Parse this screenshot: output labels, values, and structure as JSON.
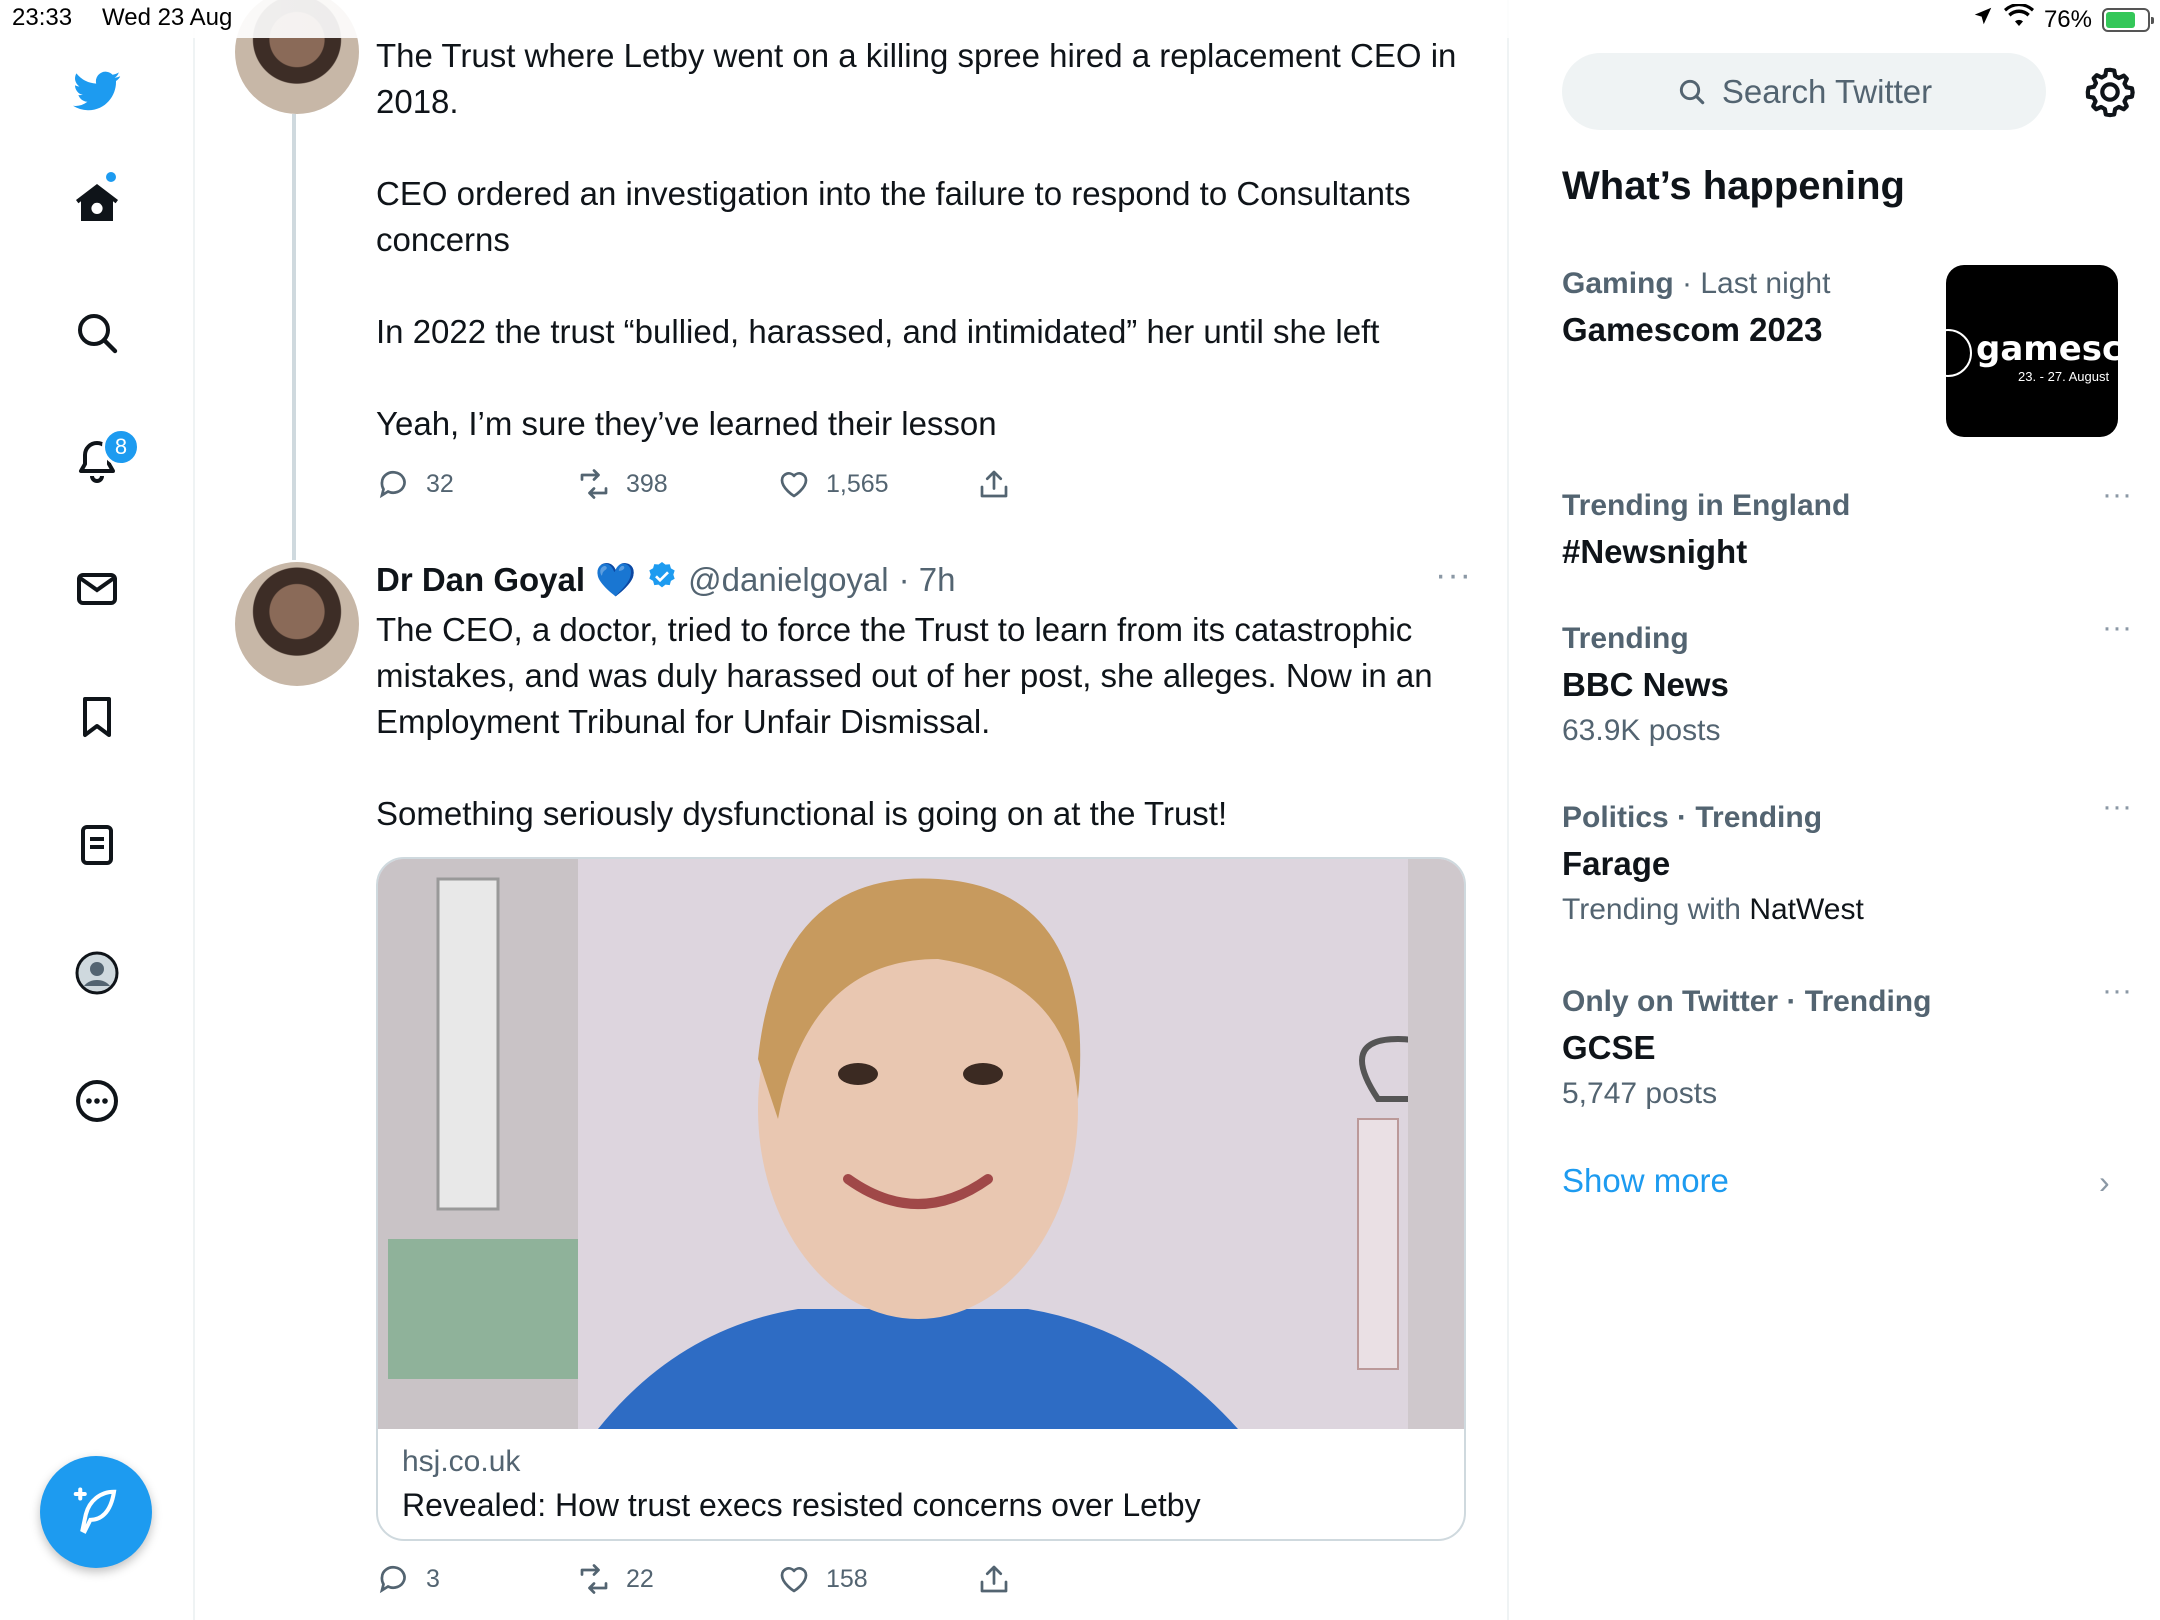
{
  "status_bar": {
    "time": "23:33",
    "date": "Wed 23 Aug",
    "battery": "76%",
    "battery_level": 0.76
  },
  "nav": {
    "notifications_badge": "8",
    "home_has_dot": true
  },
  "tweet1": {
    "text": "The Trust where Letby went on a killing spree hired a replacement CEO in 2018.\n\nCEO ordered an investigation into the failure to respond to Consultants concerns\n\nIn 2022 the trust “bullied, harassed, and intimidated” her until she left\n\nYeah, I’m sure they’ve learned their lesson",
    "replies": "32",
    "retweets": "398",
    "likes": "1,565"
  },
  "tweet2": {
    "name": "Dr Dan Goyal",
    "emoji": "💙",
    "handle": "@danielgoyal",
    "time": "· 7h",
    "text": "The CEO, a doctor, tried to force the Trust to learn from its catastrophic mistakes, and was duly harassed out of her post, she alleges.  Now in an Employment Tribunal for Unfair Dismissal.\n\nSomething seriously dysfunctional is going on at the Trust!",
    "card": {
      "domain": "hsj.co.uk",
      "title": "Revealed: How trust execs resisted concerns over Letby"
    },
    "replies": "3",
    "retweets": "22",
    "likes": "158"
  },
  "sidebar": {
    "search_placeholder": "Search Twitter",
    "section_title": "What’s happening",
    "trends": [
      {
        "meta_a": "Gaming",
        "meta_b": " · Last night",
        "name": "Gamescom 2023",
        "sub": ""
      },
      {
        "meta_a": "Trending in England",
        "meta_b": "",
        "name": "#Newsnight",
        "sub": ""
      },
      {
        "meta_a": "Trending",
        "meta_b": "",
        "name": "BBC News",
        "sub": "63.9K posts"
      },
      {
        "meta_a": "Politics · Trending",
        "meta_b": "",
        "name": "Farage",
        "sub_a": "Trending with ",
        "sub_b": "NatWest"
      },
      {
        "meta_a": "Only on Twitter · Trending",
        "meta_b": "",
        "name": "GCSE",
        "sub": "5,747 posts"
      }
    ],
    "thumbnail": {
      "title": "gamesco",
      "dates": "23. - 27. August"
    },
    "show_more": "Show more"
  },
  "colors": {
    "accent": "#1d9bf0",
    "text": "#0f1419",
    "secondary": "#536471",
    "border": "#eff3f4"
  }
}
